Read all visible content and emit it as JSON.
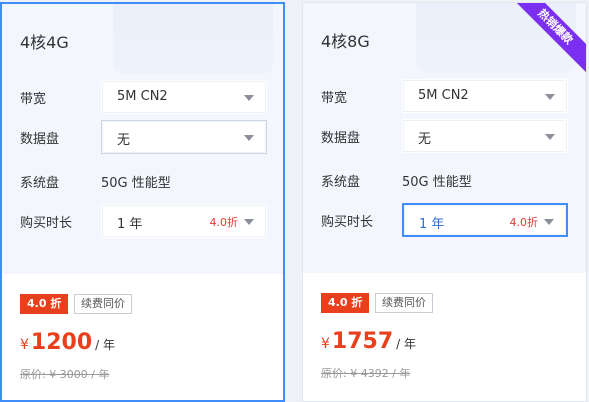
{
  "cards": [
    {
      "title": "4核4G",
      "rows": {
        "bandwidth_label": "带宽",
        "bandwidth_value": "5M CN2",
        "disk_label": "数据盘",
        "disk_value": "无",
        "system_disk_label": "系统盘",
        "system_disk_value": "50G 性能型",
        "duration_label": "购买时长",
        "duration_value": "1 年",
        "duration_discount": "4.0折"
      },
      "badge": "4.0 折",
      "renew": "续费同价",
      "price_currency": "¥",
      "price": "1200",
      "price_unit": "/ 年",
      "original": "原价: ¥ 3000 / 年"
    },
    {
      "title": "4核8G",
      "ribbon": "热销爆款",
      "rows": {
        "bandwidth_label": "带宽",
        "bandwidth_value": "5M CN2",
        "disk_label": "数据盘",
        "disk_value": "无",
        "system_disk_label": "系统盘",
        "system_disk_value": "50G 性能型",
        "duration_label": "购买时长",
        "duration_value": "1 年",
        "duration_discount": "4.0折"
      },
      "badge": "4.0 折",
      "renew": "续费同价",
      "price_currency": "¥",
      "price": "1757",
      "price_unit": "/ 年",
      "original": "原价: ¥ 4392 / 年"
    }
  ],
  "colors": {
    "accent": "#3f8ef7",
    "price": "#e8401d",
    "ribbon": "#7b2ff0"
  }
}
